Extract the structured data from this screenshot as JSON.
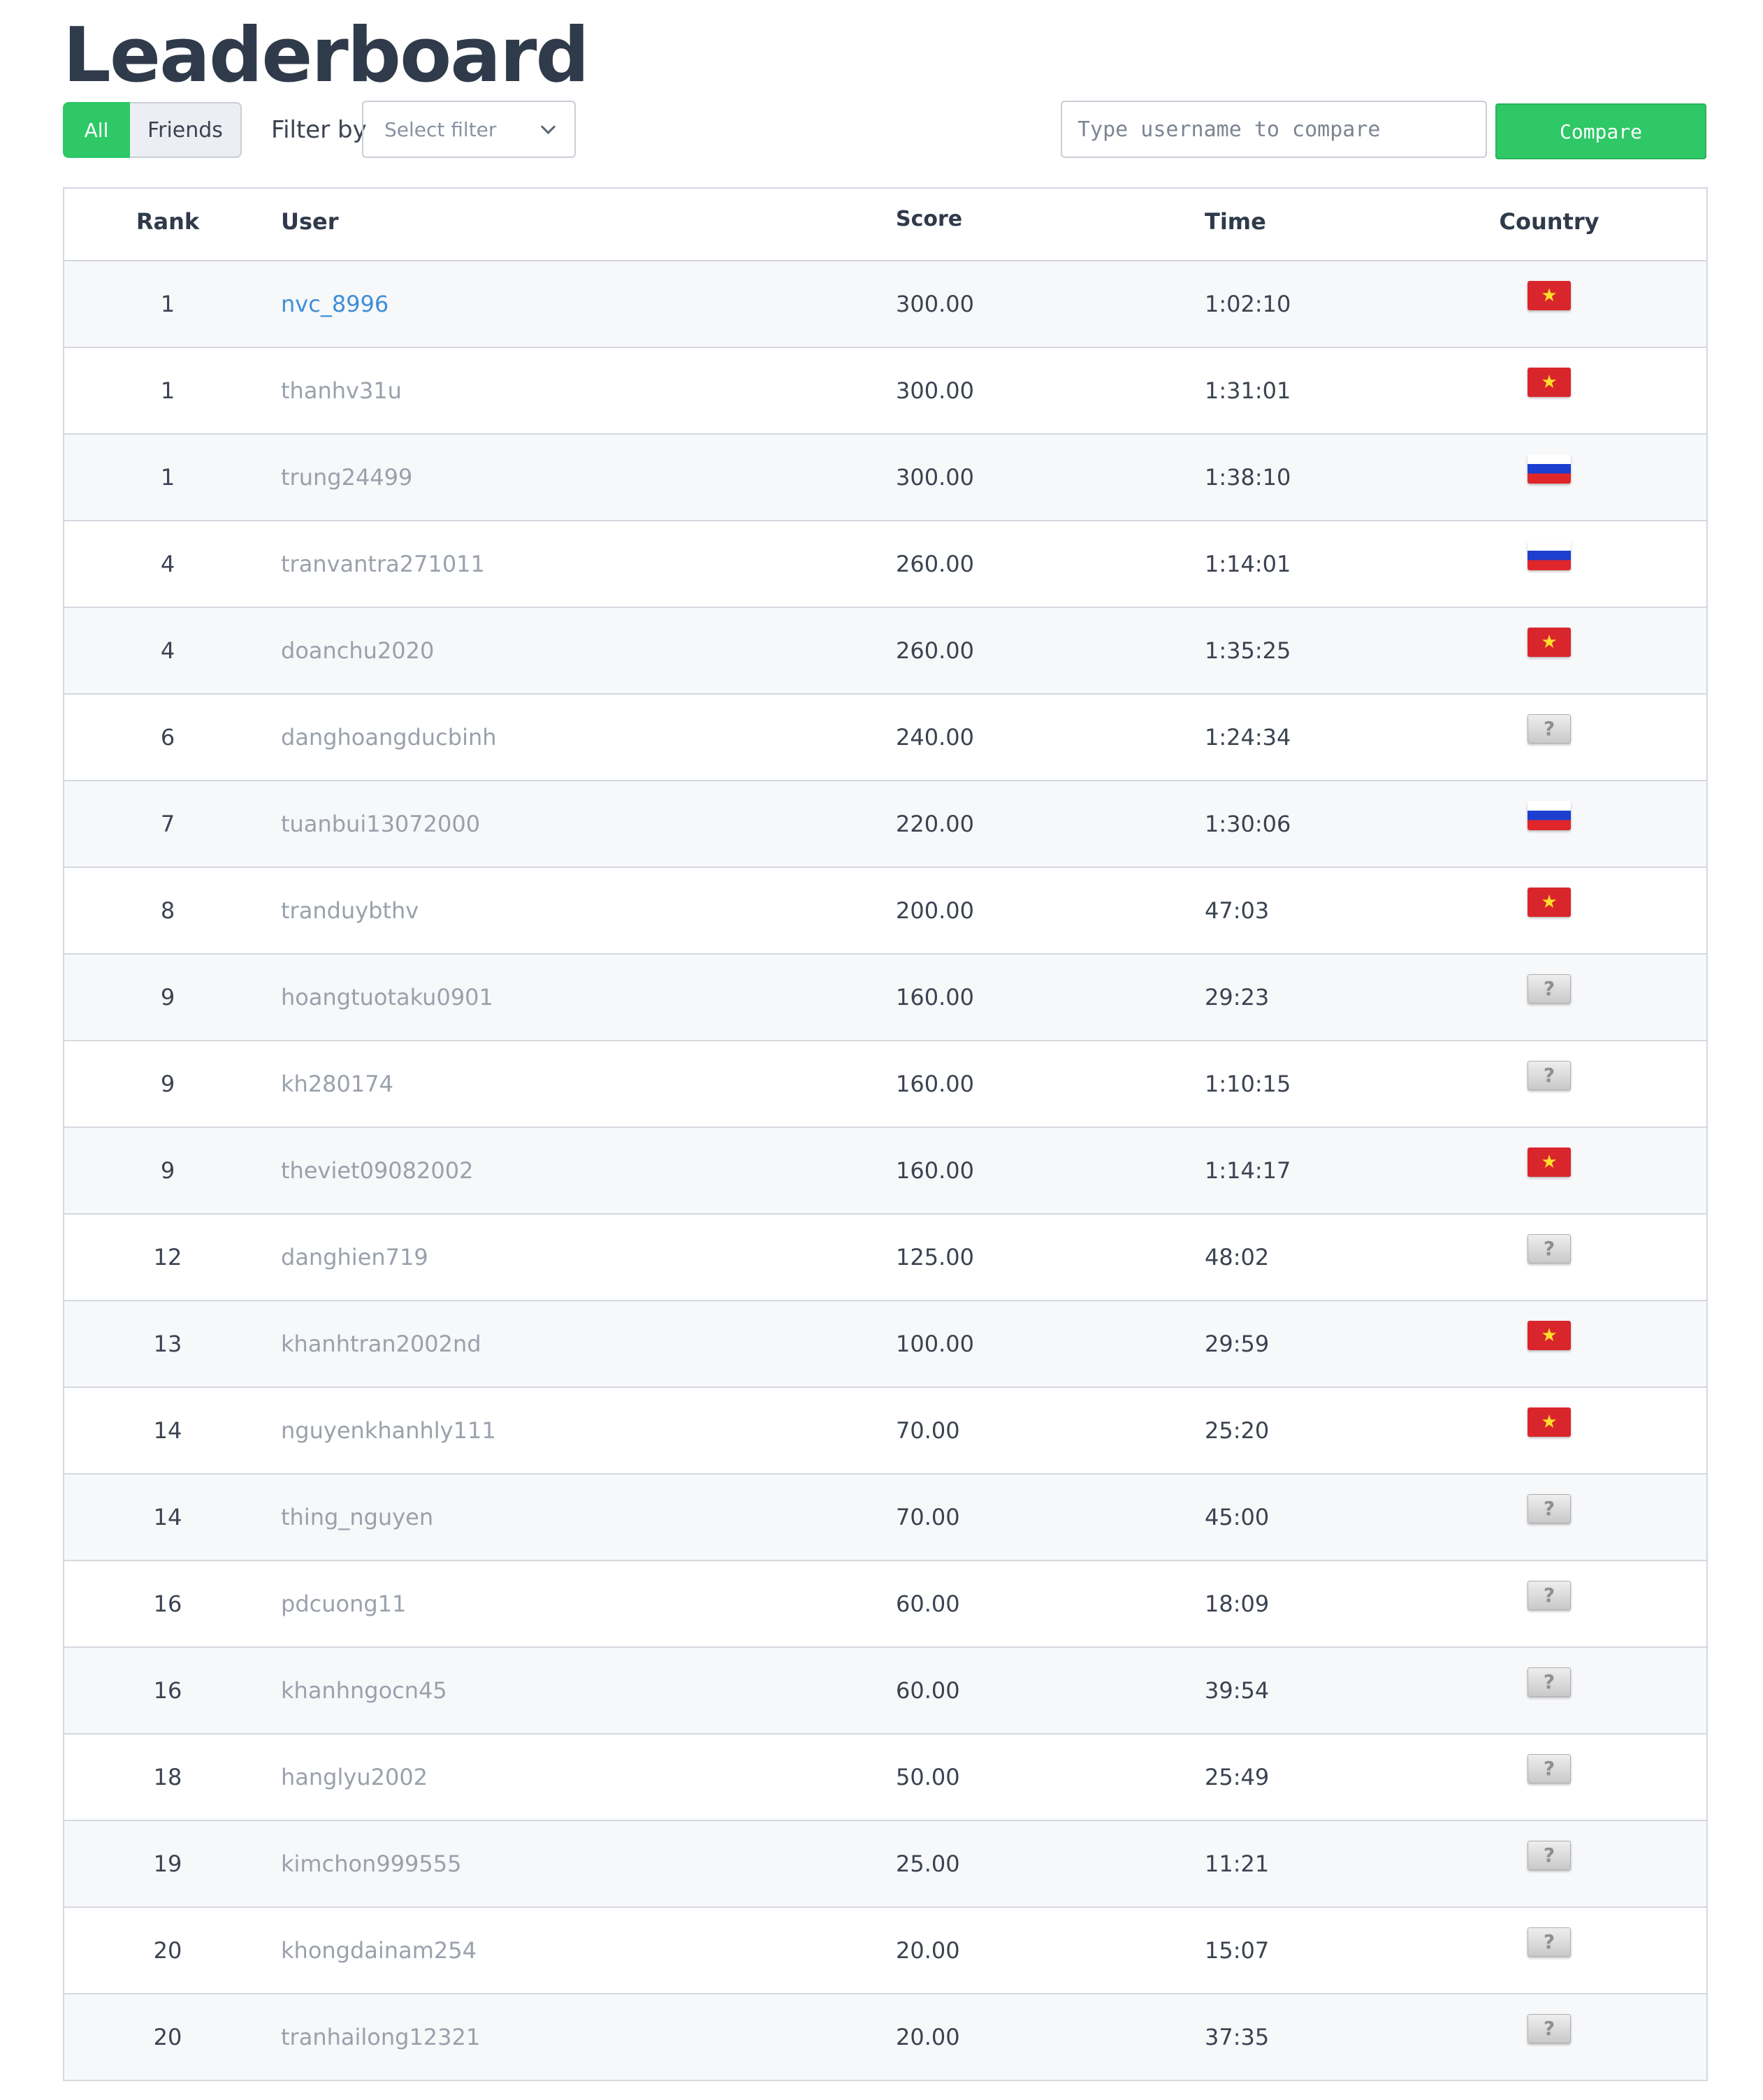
{
  "page_title": "Leaderboard",
  "toolbar": {
    "tabs": [
      {
        "label": "All",
        "active": true
      },
      {
        "label": "Friends",
        "active": false
      }
    ],
    "filter_label": "Filter by",
    "filter_placeholder": "Select filter",
    "compare_placeholder": "Type username to compare",
    "compare_label": "Compare"
  },
  "colors": {
    "accent": "#2ec866",
    "link": "#3e8fd8",
    "muted_text": "#9aa1ac"
  },
  "table": {
    "headers": {
      "rank": "Rank",
      "user": "User",
      "score": "Score",
      "time": "Time",
      "country": "Country"
    },
    "rows": [
      {
        "rank": "1",
        "user": "nvc_8996",
        "score": "300.00",
        "time": "1:02:10",
        "country_icon": "vietnam-flag-icon",
        "highlight": true
      },
      {
        "rank": "1",
        "user": "thanhv31u",
        "score": "300.00",
        "time": "1:31:01",
        "country_icon": "vietnam-flag-icon"
      },
      {
        "rank": "1",
        "user": "trung24499",
        "score": "300.00",
        "time": "1:38:10",
        "country_icon": "russia-flag-icon"
      },
      {
        "rank": "4",
        "user": "tranvantra271011",
        "score": "260.00",
        "time": "1:14:01",
        "country_icon": "russia-flag-icon"
      },
      {
        "rank": "4",
        "user": "doanchu2020",
        "score": "260.00",
        "time": "1:35:25",
        "country_icon": "vietnam-flag-icon"
      },
      {
        "rank": "6",
        "user": "danghoangducbinh",
        "score": "240.00",
        "time": "1:24:34",
        "country_icon": "unknown-flag-icon"
      },
      {
        "rank": "7",
        "user": "tuanbui13072000",
        "score": "220.00",
        "time": "1:30:06",
        "country_icon": "russia-flag-icon"
      },
      {
        "rank": "8",
        "user": "tranduybthv",
        "score": "200.00",
        "time": "47:03",
        "country_icon": "vietnam-flag-icon"
      },
      {
        "rank": "9",
        "user": "hoangtuotaku0901",
        "score": "160.00",
        "time": "29:23",
        "country_icon": "unknown-flag-icon"
      },
      {
        "rank": "9",
        "user": "kh280174",
        "score": "160.00",
        "time": "1:10:15",
        "country_icon": "unknown-flag-icon"
      },
      {
        "rank": "9",
        "user": "theviet09082002",
        "score": "160.00",
        "time": "1:14:17",
        "country_icon": "vietnam-flag-icon"
      },
      {
        "rank": "12",
        "user": "danghien719",
        "score": "125.00",
        "time": "48:02",
        "country_icon": "unknown-flag-icon"
      },
      {
        "rank": "13",
        "user": "khanhtran2002nd",
        "score": "100.00",
        "time": "29:59",
        "country_icon": "vietnam-flag-icon"
      },
      {
        "rank": "14",
        "user": "nguyenkhanhly111",
        "score": "70.00",
        "time": "25:20",
        "country_icon": "vietnam-flag-icon"
      },
      {
        "rank": "14",
        "user": "thing_nguyen",
        "score": "70.00",
        "time": "45:00",
        "country_icon": "unknown-flag-icon"
      },
      {
        "rank": "16",
        "user": "pdcuong11",
        "score": "60.00",
        "time": "18:09",
        "country_icon": "unknown-flag-icon"
      },
      {
        "rank": "16",
        "user": "khanhngocn45",
        "score": "60.00",
        "time": "39:54",
        "country_icon": "unknown-flag-icon"
      },
      {
        "rank": "18",
        "user": "hanglyu2002",
        "score": "50.00",
        "time": "25:49",
        "country_icon": "unknown-flag-icon"
      },
      {
        "rank": "19",
        "user": "kimchon999555",
        "score": "25.00",
        "time": "11:21",
        "country_icon": "unknown-flag-icon"
      },
      {
        "rank": "20",
        "user": "khongdainam254",
        "score": "20.00",
        "time": "15:07",
        "country_icon": "unknown-flag-icon"
      },
      {
        "rank": "20",
        "user": "tranhailong12321",
        "score": "20.00",
        "time": "37:35",
        "country_icon": "unknown-flag-icon"
      }
    ]
  }
}
